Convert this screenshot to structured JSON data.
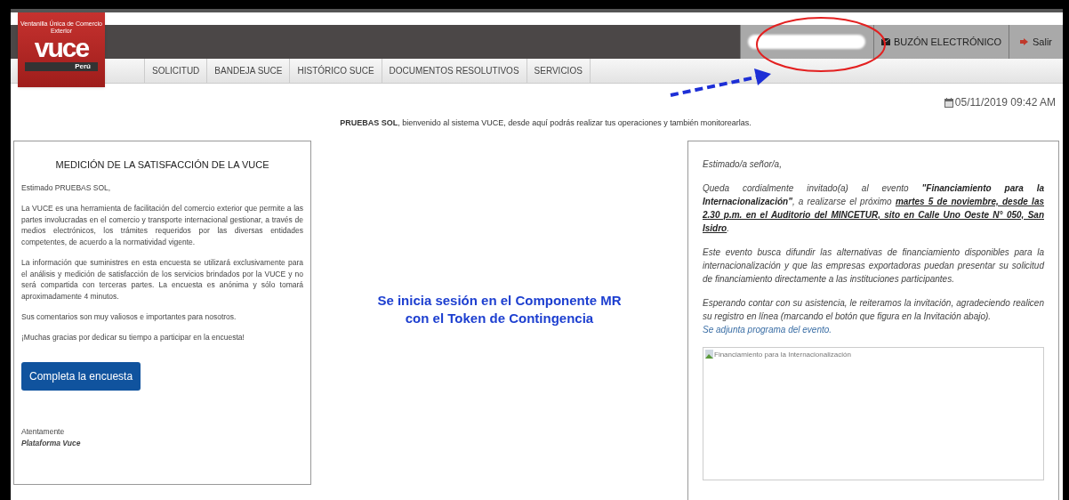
{
  "logo": {
    "tagline": "Ventanilla Única de Comercio Exterior",
    "name": "vuce",
    "country": "Perú"
  },
  "top_bar": {
    "user_field": {
      "kind": "redacted"
    },
    "mailbox": "BUZÓN ELECTRÓNICO",
    "logout": "Salir"
  },
  "nav": [
    {
      "label": "SOLICITUD"
    },
    {
      "label": "BANDEJA SUCE"
    },
    {
      "label": "HISTÓRICO SUCE"
    },
    {
      "label": "DOCUMENTOS RESOLUTIVOS"
    },
    {
      "label": "SERVICIOS"
    }
  ],
  "datetime": "05/11/2019 09:42 AM",
  "welcome": "**PRUEBAS SOL**, bienvenido al sistema VUCE, desde aquí podrás realizar tus operaciones y también monitorearlas.",
  "survey": {
    "title": "MEDICIÓN DE LA SATISFACCIÓN DE LA VUCE",
    "greeting": "Estimado PRUEBAS SOL,",
    "paragraphs": [
      "La VUCE es una herramienta de facilitación del comercio exterior que permite a las partes involucradas en el comercio y transporte internacional gestionar, a través de medios electrónicos, los trámites requeridos por las diversas entidades competentes, de acuerdo a la normatividad vigente.",
      "La información que suministres en esta encuesta se utilizará exclusivamente para el análisis y medición de satisfacción de los servicios brindados por la VUCE y no será compartida con terceras partes. La encuesta es anónima y sólo tomará aproximadamente 4 minutos.",
      "Sus comentarios son muy valiosos e importantes para nosotros.",
      "¡Muchas gracias por dedicar su tiempo a participar en la encuesta!"
    ],
    "button": "Completa la encuesta",
    "closing": "Atentamente",
    "signature": "Plataforma Vuce"
  },
  "notice": "Se inicia sesión en el Componente MR con el Token de Contingencia",
  "invitation": {
    "greeting": "Estimado/a señor/a,",
    "invite": [
      {
        "kind": "plain",
        "text": "Queda cordialmente invitado(a) al evento "
      },
      {
        "kind": "bold",
        "text": "\"Financiamiento para la Internacionalización\""
      },
      {
        "kind": "plain",
        "text": ", a realizarse el próximo "
      },
      {
        "kind": "underline",
        "text": "martes 5 de noviembre, desde las 2.30 p.m. en el Auditorio del MINCETUR, sito en Calle Uno Oeste N° 050, San Isidro"
      },
      {
        "kind": "plain",
        "text": "."
      }
    ],
    "paragraphs": [
      "Este evento busca difundir las alternativas de financiamiento disponibles para la internacionalización y que las empresas exportadoras puedan presentar su solicitud de financiamiento directamente a las instituciones participantes.",
      "Esperando contar con su asistencia, le reiteramos la invitación, agradeciendo realicen su registro en línea (marcando el botón que figura en la Invitación abajo)."
    ],
    "link": "Se adjunta programa del evento.",
    "image_alt": "Financiamiento para la Internacionalización"
  }
}
